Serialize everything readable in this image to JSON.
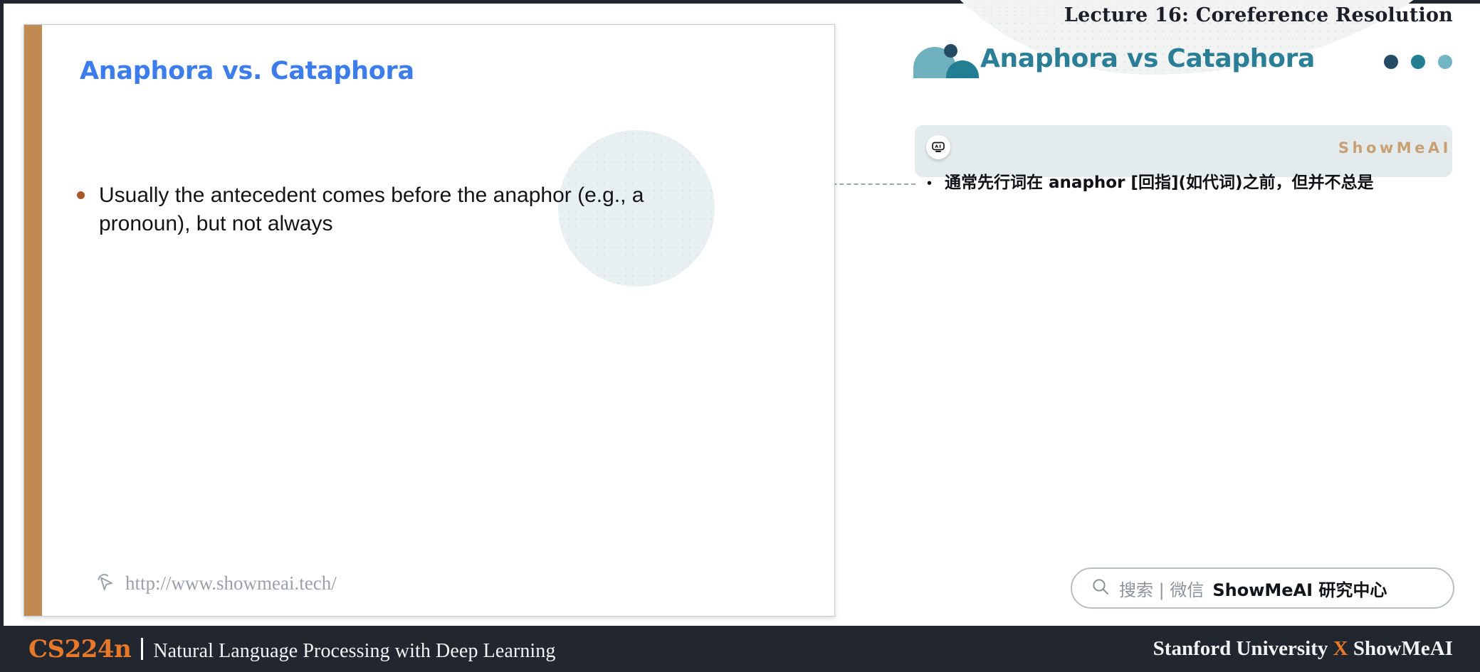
{
  "header": {
    "lecture_title": "Lecture 16: Coreference Resolution",
    "panel_title": "Anaphora vs Cataphora",
    "logo_icon": "showmeai-logo-icon",
    "dots": [
      {
        "name": "dot-dark",
        "color": "#254a63"
      },
      {
        "name": "dot-medium",
        "color": "#227e92"
      },
      {
        "name": "dot-light",
        "color": "#72b5c4"
      }
    ]
  },
  "translation_card": {
    "badge_icon": "ai-robot-badge-icon",
    "badge_label": "AI",
    "brand_mark": "ShowMeAI",
    "bullet_marker": "•",
    "text": "通常先行词在 anaphor [回指](如代词)之前，但并不总是",
    "background_color": "#e3ebed"
  },
  "slide": {
    "accent_color": "#c28a53",
    "title": "Anaphora vs. Cataphora",
    "title_color": "#3c7ceb",
    "bullet_marker_color": "#b0562a",
    "bullet_text": "Usually the antecedent comes before the anaphor (e.g., a pronoun), but not always",
    "watermark_icon": "cursor-pointer-icon",
    "watermark_url": "http://www.showmeai.tech/"
  },
  "search": {
    "icon": "search-icon",
    "placeholder": "搜索 | 微信",
    "brand": "ShowMeAI 研究中心"
  },
  "footer": {
    "course_code": "CS224n",
    "course_subtitle": "Natural Language Processing with Deep Learning",
    "partner_left": "Stanford University",
    "partner_x": "X",
    "partner_right": "ShowMeAI",
    "background_color": "#22262e",
    "accent_color": "#e8792a"
  }
}
